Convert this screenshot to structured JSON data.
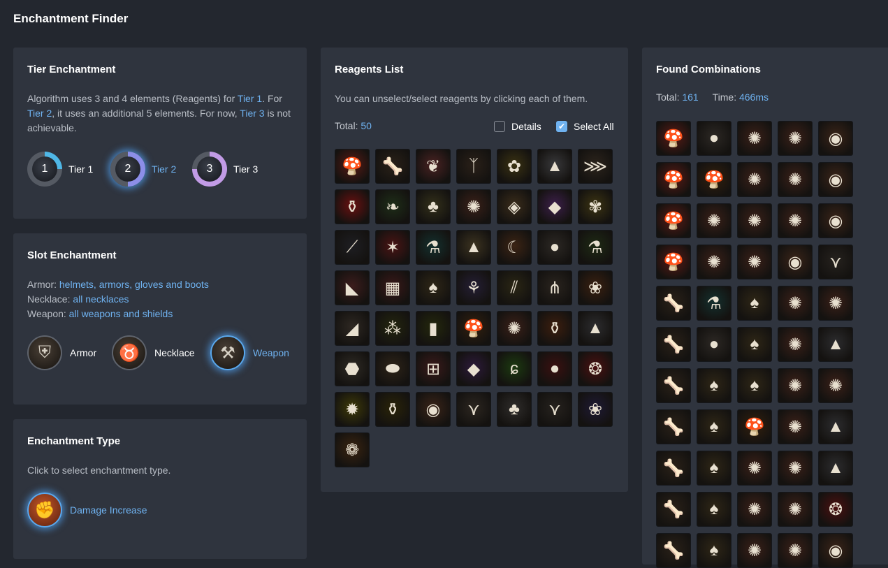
{
  "page": {
    "title": "Enchantment Finder"
  },
  "tier": {
    "title": "Tier Enchantment",
    "desc": {
      "p1": "Algorithm uses 3 and 4 elements (Reagents) for ",
      "t1": "Tier 1",
      "p2": ". For ",
      "t2": "Tier 2",
      "p3": ", it uses an additional 5 elements. For now, ",
      "t3": "Tier 3",
      "p4": " is not achievable."
    },
    "options": [
      {
        "num": "1",
        "label": "Tier 1",
        "color": "#4fb7e6"
      },
      {
        "num": "2",
        "label": "Tier 2",
        "color": "#8c8ee8"
      },
      {
        "num": "3",
        "label": "Tier 3",
        "color": "#c29be6"
      }
    ]
  },
  "slot": {
    "title": "Slot Enchantment",
    "lines": [
      {
        "key": "Armor: ",
        "value": "helmets, armors, gloves and boots"
      },
      {
        "key": "Necklace: ",
        "value": "all necklaces"
      },
      {
        "key": "Weapon: ",
        "value": "all weapons and shields"
      }
    ],
    "options": [
      {
        "label": "Armor",
        "icon": "armor-icon",
        "glyph": "⛨"
      },
      {
        "label": "Necklace",
        "icon": "necklace-icon",
        "glyph": "♉"
      },
      {
        "label": "Weapon",
        "icon": "axe-icon",
        "glyph": "⚒"
      }
    ]
  },
  "type": {
    "title": "Enchantment Type",
    "desc": "Click to select enchantment type.",
    "selected": "Damage Increase",
    "icon": "fist-icon"
  },
  "reagents": {
    "title": "Reagents List",
    "desc": "You can unselect/select reagents by clicking each of them.",
    "total_label": "Total: ",
    "total": "50",
    "details_label": "Details",
    "select_all_label": "Select All",
    "items": [
      {
        "icon": "mushroom-icon",
        "glyph": "🍄",
        "bg": "#5a1a14"
      },
      {
        "icon": "bones-icon",
        "glyph": "🦴",
        "bg": "#2a2118"
      },
      {
        "icon": "root-icon",
        "glyph": "❦",
        "bg": "#4a2222"
      },
      {
        "icon": "antler-icon",
        "glyph": "ᛉ",
        "bg": "#2a2018"
      },
      {
        "icon": "flower-icon",
        "glyph": "✿",
        "bg": "#3a3212"
      },
      {
        "icon": "salt-icon",
        "glyph": "▲",
        "bg": "#38383a"
      },
      {
        "icon": "claw-icon",
        "glyph": "⋙",
        "bg": "#2c241c"
      },
      {
        "icon": "potion-icon",
        "glyph": "⚱",
        "bg": "#6a1010"
      },
      {
        "icon": "leaf-icon",
        "glyph": "❧",
        "bg": "#1e2e18"
      },
      {
        "icon": "herb-icon",
        "glyph": "♣",
        "bg": "#33301a"
      },
      {
        "icon": "coral-icon",
        "glyph": "✺",
        "bg": "#3a2018"
      },
      {
        "icon": "bark-icon",
        "glyph": "◈",
        "bg": "#3a2c1a"
      },
      {
        "icon": "crystal-icon",
        "glyph": "◆",
        "bg": "#3c1f4a"
      },
      {
        "icon": "dandelion-icon",
        "glyph": "✾",
        "bg": "#3c3412"
      },
      {
        "icon": "feather-icon",
        "glyph": "⟋",
        "bg": "#1e1e22"
      },
      {
        "icon": "red-crystal-icon",
        "glyph": "✶",
        "bg": "#4a1414"
      },
      {
        "icon": "vial-icon",
        "glyph": "⚗",
        "bg": "#14302e"
      },
      {
        "icon": "dust-icon",
        "glyph": "▲",
        "bg": "#3c3320"
      },
      {
        "icon": "horn-icon",
        "glyph": "☾",
        "bg": "#3c2414"
      },
      {
        "icon": "garlic-icon",
        "glyph": "●",
        "bg": "#2c2824"
      },
      {
        "icon": "vial-green-icon",
        "glyph": "⚗",
        "bg": "#1e2a14"
      },
      {
        "icon": "tooth-icon",
        "glyph": "◣",
        "bg": "#3c1c1c"
      },
      {
        "icon": "meat-icon",
        "glyph": "▦",
        "bg": "#3a1818"
      },
      {
        "icon": "mushrooms-icon",
        "glyph": "♠",
        "bg": "#2e2616"
      },
      {
        "icon": "lavender-icon",
        "glyph": "⚘",
        "bg": "#241e34"
      },
      {
        "icon": "stalks-icon",
        "glyph": "⫽",
        "bg": "#2a2614"
      },
      {
        "icon": "root-white-icon",
        "glyph": "⋔",
        "bg": "#2a241e"
      },
      {
        "icon": "marigold-icon",
        "glyph": "❀",
        "bg": "#3a2010"
      },
      {
        "icon": "horn-white-icon",
        "glyph": "◢",
        "bg": "#2e2822"
      },
      {
        "icon": "berries-icon",
        "glyph": "⁂",
        "bg": "#24260e"
      },
      {
        "icon": "tube-icon",
        "glyph": "▮",
        "bg": "#24280c"
      },
      {
        "icon": "brown-mushroom-icon",
        "glyph": "🍄",
        "bg": "#33200e"
      },
      {
        "icon": "coral-red-icon",
        "glyph": "✺",
        "bg": "#3a2018"
      },
      {
        "icon": "orange-flask-icon",
        "glyph": "⚱",
        "bg": "#3c1e0e"
      },
      {
        "icon": "ash-icon",
        "glyph": "▲",
        "bg": "#2c2c2e"
      },
      {
        "icon": "egg-icon",
        "glyph": "⬣",
        "bg": "#2e2a24"
      },
      {
        "icon": "peanut-icon",
        "glyph": "⬬",
        "bg": "#2e2418"
      },
      {
        "icon": "drum-icon",
        "glyph": "⊞",
        "bg": "#3a1a1a"
      },
      {
        "icon": "shard-icon",
        "glyph": "◆",
        "bg": "#2c1a3a"
      },
      {
        "icon": "wisp-icon",
        "glyph": "ɕ",
        "bg": "#1c3a10"
      },
      {
        "icon": "orb-icon",
        "glyph": "●",
        "bg": "#3a1010"
      },
      {
        "icon": "pinecone-icon",
        "glyph": "❂",
        "bg": "#4a1010"
      },
      {
        "icon": "gold-ore-icon",
        "glyph": "✹",
        "bg": "#3e3a08"
      },
      {
        "icon": "yellow-flask-icon",
        "glyph": "⚱",
        "bg": "#2a2408"
      },
      {
        "icon": "shell-icon",
        "glyph": "◉",
        "bg": "#3a2418"
      },
      {
        "icon": "fangs-icon",
        "glyph": "⋎",
        "bg": "#2c2620"
      },
      {
        "icon": "white-mushrooms-icon",
        "glyph": "♣",
        "bg": "#2e2c2a"
      },
      {
        "icon": "teeth-icon",
        "glyph": "⋎",
        "bg": "#26221e"
      },
      {
        "icon": "bellflower-icon",
        "glyph": "❀",
        "bg": "#1e1a34"
      },
      {
        "icon": "brain-icon",
        "glyph": "❁",
        "bg": "#3a2410"
      }
    ]
  },
  "combos": {
    "title": "Found Combinations",
    "total_label": "Total: ",
    "total": "161",
    "time_label": "Time: ",
    "time": "466ms",
    "rows": [
      [
        0,
        "garlic",
        "coral",
        "coral",
        "shell"
      ],
      [
        0,
        "brownmush",
        "coral",
        "coral",
        "shell"
      ],
      [
        0,
        "coral",
        "coral",
        "coral",
        "shell"
      ],
      [
        0,
        "coral",
        "coral",
        "shell",
        "teeth"
      ],
      [
        "bones",
        "vial",
        "mushrooms",
        "coral",
        "coral"
      ],
      [
        "bones",
        "garlic",
        "mushrooms",
        "coral",
        "ash"
      ],
      [
        "bones",
        "mushrooms",
        "mushrooms",
        "coral",
        "coral"
      ],
      [
        "bones",
        "mushrooms",
        "brownmush",
        "coral",
        "ash"
      ],
      [
        "bones",
        "mushrooms",
        "coral",
        "coral",
        "ash"
      ],
      [
        "bones",
        "mushrooms",
        "coral",
        "coral",
        "pinecone"
      ],
      [
        "bones",
        "mushrooms",
        "coral",
        "coral",
        "shell"
      ]
    ]
  }
}
